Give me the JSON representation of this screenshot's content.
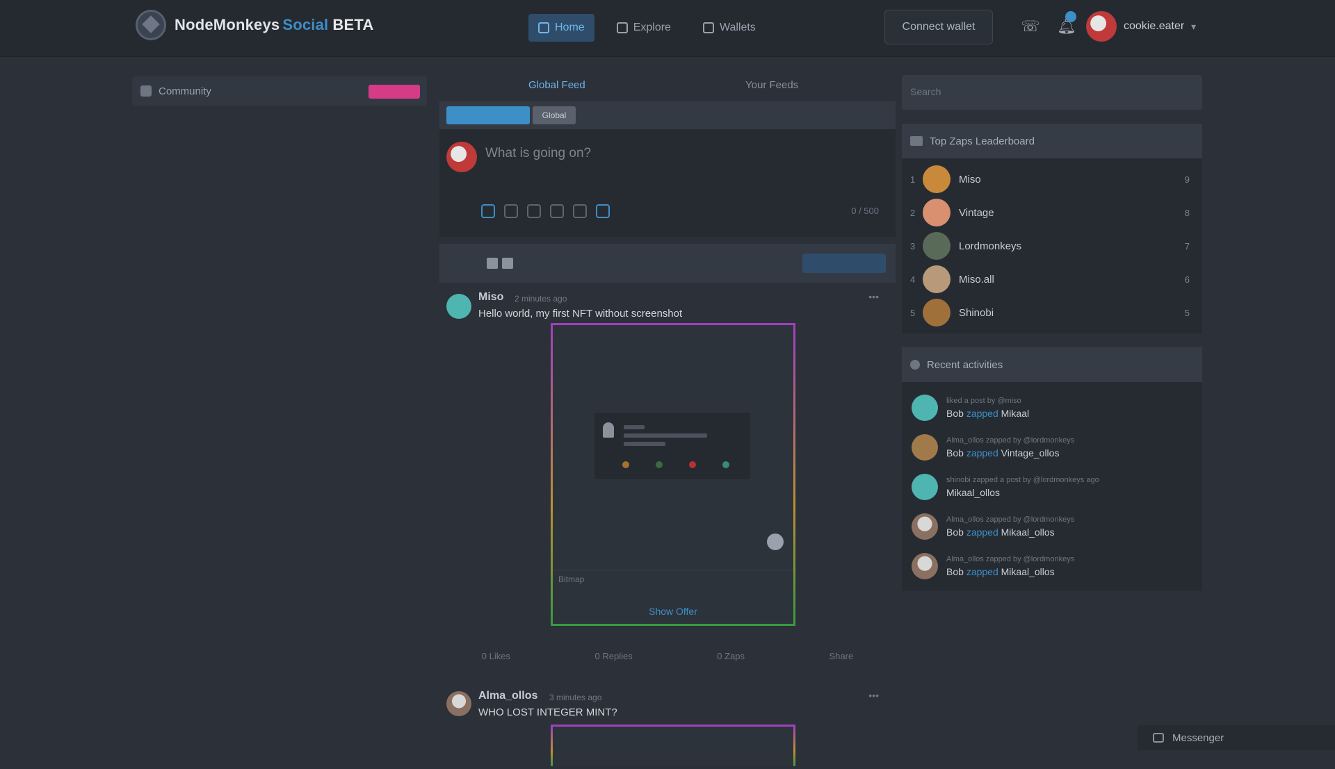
{
  "header": {
    "brand": "NodeMonkeys",
    "brand_accent": "Social",
    "brand_tag": "BETA",
    "nav": [
      {
        "label": "Home",
        "active": true
      },
      {
        "label": "Explore",
        "active": false
      },
      {
        "label": "Wallets",
        "active": false
      }
    ],
    "connect_label": "Connect wallet",
    "user_name": "cookie.eater"
  },
  "left_panel": {
    "label": "Community"
  },
  "feed": {
    "tabs": [
      "Global Feed",
      "Your Feeds"
    ],
    "filter_second": "Global",
    "composer_placeholder": "What is going on?",
    "post_label": "0 / 500",
    "posts": [
      {
        "author": "Miso",
        "time": "2 minutes ago",
        "text": "Hello world, my first NFT without screenshot",
        "nft_footer": "Bitmap",
        "nft_view": "Show Offer",
        "stats": [
          "0 Likes",
          "0 Replies",
          "0 Zaps",
          "Share"
        ]
      },
      {
        "author": "Alma_ollos",
        "time": "3 minutes ago",
        "text": "WHO LOST INTEGER MINT?"
      }
    ]
  },
  "right": {
    "search_placeholder": "Search",
    "leaderboard_title": "Top Zaps Leaderboard",
    "leaderboard": [
      {
        "rank": "1",
        "name": "Miso",
        "score": "9"
      },
      {
        "rank": "2",
        "name": "Vintage",
        "score": "8"
      },
      {
        "rank": "3",
        "name": "Lordmonkeys",
        "score": "7"
      },
      {
        "rank": "4",
        "name": "Miso.all",
        "score": "6"
      },
      {
        "rank": "5",
        "name": "Shinobi",
        "score": "5"
      }
    ],
    "activities_title": "Recent activities",
    "activities": [
      {
        "top": "liked a post by @miso",
        "pre": "Bob",
        "mid": "zapped",
        "post": "Mikaal"
      },
      {
        "top": "Alma_ollos zapped by @lordmonkeys",
        "pre": "Bob",
        "mid": "zapped",
        "post": "Vintage_ollos"
      },
      {
        "top": "shinobi zapped a post by @lordmonkeys ago",
        "pre": "",
        "mid": "",
        "post": "Mikaal_ollos"
      },
      {
        "top": "Alma_ollos zapped by @lordmonkeys",
        "pre": "Bob",
        "mid": "zapped",
        "post": "Mikaal_ollos"
      },
      {
        "top": "Alma_ollos zapped by @lordmonkeys",
        "pre": "Bob",
        "mid": "zapped",
        "post": "Mikaal_ollos"
      }
    ]
  },
  "messenger": {
    "label": "Messenger"
  }
}
